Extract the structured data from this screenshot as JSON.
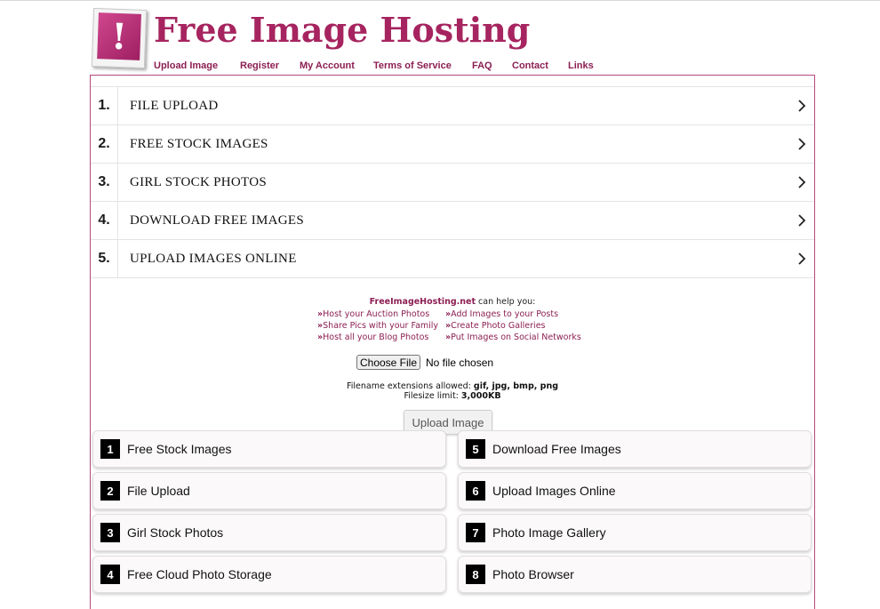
{
  "header": {
    "logo_symbol": "!",
    "title": "Free Image Hosting",
    "nav": [
      "Upload Image",
      "Register",
      "My Account",
      "Terms of Service",
      "FAQ",
      "Contact",
      "Links"
    ]
  },
  "ads": {
    "items": [
      {
        "num": "1.",
        "label": "FILE UPLOAD"
      },
      {
        "num": "2.",
        "label": "FREE STOCK IMAGES"
      },
      {
        "num": "3.",
        "label": "GIRL STOCK PHOTOS"
      },
      {
        "num": "4.",
        "label": "DOWNLOAD FREE IMAGES"
      },
      {
        "num": "5.",
        "label": "UPLOAD IMAGES ONLINE"
      }
    ]
  },
  "info": {
    "site_name": "FreeImageHosting.net",
    "help_text": " can help you:",
    "bullet": "»",
    "features": [
      "Host your Auction Photos",
      "Add Images to your Posts",
      "Share Pics with your Family",
      "Create Photo Galleries",
      "Host all your Blog Photos",
      "Put Images on Social Networks"
    ]
  },
  "upload": {
    "choose_label": "Choose File",
    "no_file_label": "No file chosen",
    "ext_label": "Filename extensions allowed: ",
    "ext_value": "gif, jpg, bmp, png",
    "size_label": "Filesize limit: ",
    "size_value": "3,000KB",
    "button_label": "Upload Image"
  },
  "links_grid": [
    {
      "num": "1",
      "label": "Free Stock Images"
    },
    {
      "num": "2",
      "label": "File Upload"
    },
    {
      "num": "3",
      "label": "Girl Stock Photos"
    },
    {
      "num": "4",
      "label": "Free Cloud Photo Storage"
    },
    {
      "num": "5",
      "label": "Download Free Images"
    },
    {
      "num": "6",
      "label": "Upload Images Online"
    },
    {
      "num": "7",
      "label": "Photo Image Gallery"
    },
    {
      "num": "8",
      "label": "Photo Browser"
    }
  ],
  "colors": {
    "brand": "#a6245f",
    "link": "#8c1f53",
    "ad_icon": "#2a9fd6"
  },
  "icons": {
    "ad_choices": "adchoices-icon",
    "chevron": "chevron-right-icon"
  }
}
